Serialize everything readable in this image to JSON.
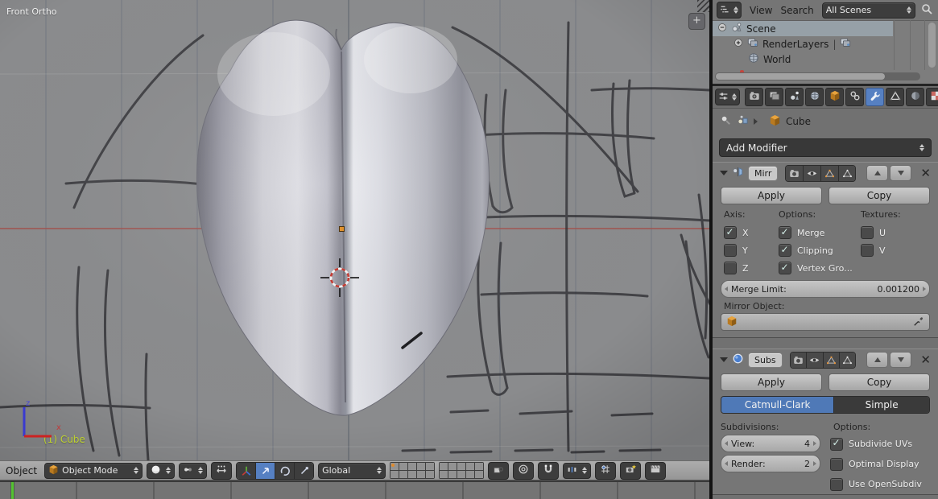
{
  "colors": {
    "accent_blue": "#5680c2",
    "segment_active_blue": "#4f79b7",
    "checkmark_teal": "#d4efe8",
    "active_object_text": "#bed230",
    "outliner_selection": "#96a0a7",
    "timeline_playhead_green": "#55c232",
    "axis_x_red": "#c03a3a",
    "axis_z_blue": "#4545d8",
    "viewport_axis_line_red": "#a84b46",
    "layer_dot_orange": "#e08b2d"
  },
  "viewport": {
    "view_label": "Front Ortho",
    "active_object_label": "(1) Cube",
    "axis_z": "z",
    "axis_x": "x",
    "expand_button": "+"
  },
  "header": {
    "object_menu_label": "Object",
    "mode_value": "Object Mode",
    "orientation_value": "Global"
  },
  "outliner": {
    "view_label": "View",
    "search_label": "Search",
    "scenes_value": "All Scenes",
    "scene_item": "Scene",
    "renderlayers_item": "RenderLayers",
    "renderlayers_separator": "|",
    "world_item": "World"
  },
  "properties": {
    "breadcrumb_object": "Cube",
    "add_modifier_label": "Add Modifier",
    "mirror": {
      "name": "Mirr",
      "apply_label": "Apply",
      "copy_label": "Copy",
      "axis_label": "Axis:",
      "options_label": "Options:",
      "textures_label": "Textures:",
      "axis": [
        {
          "label": "X",
          "checked": true
        },
        {
          "label": "Y",
          "checked": false
        },
        {
          "label": "Z",
          "checked": false
        }
      ],
      "options": [
        {
          "label": "Merge",
          "checked": true
        },
        {
          "label": "Clipping",
          "checked": true
        },
        {
          "label": "Vertex Gro...",
          "checked": true
        }
      ],
      "textures": [
        {
          "label": "U",
          "checked": false
        },
        {
          "label": "V",
          "checked": false
        }
      ],
      "merge_limit_label": "Merge Limit:",
      "merge_limit_value": "0.001200",
      "mirror_object_label": "Mirror Object:"
    },
    "subsurf": {
      "name": "Subs",
      "apply_label": "Apply",
      "copy_label": "Copy",
      "type_segments": [
        {
          "label": "Catmull-Clark",
          "active": true
        },
        {
          "label": "Simple",
          "active": false
        }
      ],
      "subdivisions_label": "Subdivisions:",
      "view_label": "View:",
      "view_value": "4",
      "render_label": "Render:",
      "render_value": "2",
      "options_label": "Options:",
      "options": [
        {
          "label": "Subdivide UVs",
          "checked": true
        },
        {
          "label": "Optimal Display",
          "checked": false
        },
        {
          "label": "Use OpenSubdiv",
          "checked": false
        }
      ]
    }
  },
  "icons": [
    "outliner-editor-icon",
    "properties-editor-icon",
    "search-icon",
    "render-tab-icon",
    "render-layers-tab-icon",
    "scene-tab-icon",
    "world-tab-icon",
    "object-tab-icon",
    "constraints-tab-icon",
    "modifiers-tab-icon",
    "data-tab-icon",
    "material-tab-icon",
    "texture-tab-icon",
    "particles-tab-icon",
    "physics-tab-icon",
    "pin-icon",
    "cube-icon",
    "mirror-modifier-icon",
    "subsurf-modifier-icon",
    "render-toggle-icon",
    "eye-icon",
    "editmode-toggle-icon",
    "cage-toggle-icon",
    "eyedropper-icon",
    "sphere-shading-icon",
    "pivot-icon",
    "manipulator-toggle-icon",
    "axis-manipulator-icon",
    "translate-icon",
    "rotate-icon",
    "scale-icon",
    "magnet-icon",
    "proportional-icon",
    "snap-element-icon",
    "snap-target-icon",
    "ogl-render-icon",
    "ogl-anim-icon",
    "lock-icon"
  ]
}
